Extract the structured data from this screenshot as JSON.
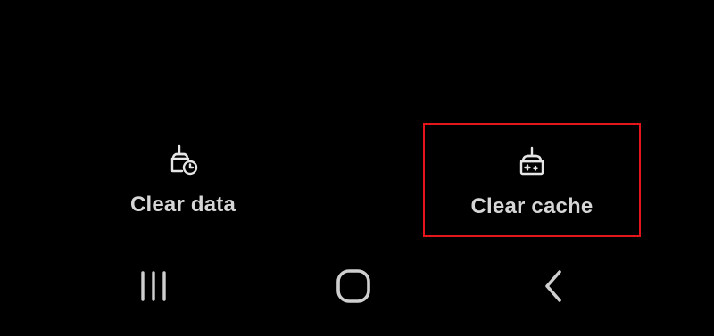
{
  "actions": {
    "clear_data": {
      "label": "Clear data",
      "icon": "broom-clock-icon"
    },
    "clear_cache": {
      "label": "Clear cache",
      "icon": "broom-sparkle-icon",
      "highlight_color": "#e3161c"
    }
  },
  "navbar": {
    "recents_icon": "recents-icon",
    "home_icon": "home-icon",
    "back_icon": "back-icon"
  },
  "colors": {
    "background": "#000000",
    "text": "#d6d6d6",
    "icon": "#e6e6e6",
    "nav_icon": "#cfcfcf",
    "highlight": "#e3161c"
  }
}
